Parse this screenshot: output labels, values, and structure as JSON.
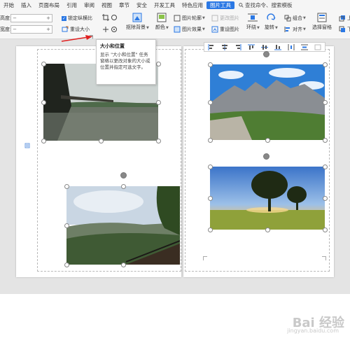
{
  "menu": {
    "items": [
      "开始",
      "插入",
      "页面布局",
      "引用",
      "审阅",
      "视图",
      "章节",
      "安全",
      "开发工具",
      "特色应用"
    ],
    "active_tab": "图片工具",
    "search": "查找命令、搜索模板"
  },
  "ribbon": {
    "height_label": "高度:",
    "width_label": "宽度:",
    "spin_minus": "−",
    "spin_plus": "+",
    "lock_ratio": "锁定纵横比",
    "reset_size": "重设大小",
    "remove_bg": "抠除背景",
    "color": "颜色",
    "picture_outline": "图片轮廓",
    "picture_effects": "图片效果",
    "change_picture": "更改图片",
    "reset_picture": "重设图片",
    "wrap": "环绕",
    "rotate": "旋转",
    "group": "组合",
    "align": "对齐",
    "select_pane": "选择窗格",
    "bring_forward": "上移",
    "send_backward": "下移"
  },
  "tooltip": {
    "title": "大小和位置",
    "body": "显示 \"大小和位置\" 任务窗格以更改对象的大小或位置并指定可选文字。"
  },
  "watermark": {
    "brand": "Bai 经验",
    "url": "jingyan.baidu.com"
  },
  "colors": {
    "accent": "#2b78e4",
    "arrow": "#e02020"
  }
}
